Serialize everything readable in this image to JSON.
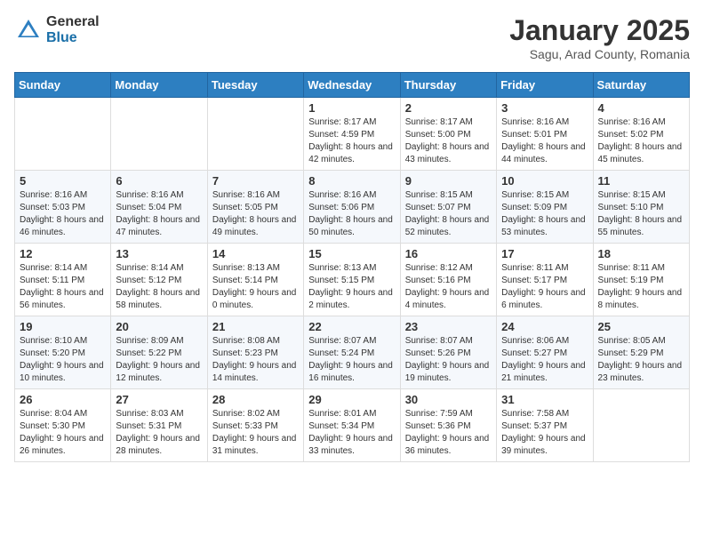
{
  "header": {
    "logo_general": "General",
    "logo_blue": "Blue",
    "month": "January 2025",
    "location": "Sagu, Arad County, Romania"
  },
  "weekdays": [
    "Sunday",
    "Monday",
    "Tuesday",
    "Wednesday",
    "Thursday",
    "Friday",
    "Saturday"
  ],
  "weeks": [
    [
      {
        "day": "",
        "info": ""
      },
      {
        "day": "",
        "info": ""
      },
      {
        "day": "",
        "info": ""
      },
      {
        "day": "1",
        "info": "Sunrise: 8:17 AM\nSunset: 4:59 PM\nDaylight: 8 hours and 42 minutes."
      },
      {
        "day": "2",
        "info": "Sunrise: 8:17 AM\nSunset: 5:00 PM\nDaylight: 8 hours and 43 minutes."
      },
      {
        "day": "3",
        "info": "Sunrise: 8:16 AM\nSunset: 5:01 PM\nDaylight: 8 hours and 44 minutes."
      },
      {
        "day": "4",
        "info": "Sunrise: 8:16 AM\nSunset: 5:02 PM\nDaylight: 8 hours and 45 minutes."
      }
    ],
    [
      {
        "day": "5",
        "info": "Sunrise: 8:16 AM\nSunset: 5:03 PM\nDaylight: 8 hours and 46 minutes."
      },
      {
        "day": "6",
        "info": "Sunrise: 8:16 AM\nSunset: 5:04 PM\nDaylight: 8 hours and 47 minutes."
      },
      {
        "day": "7",
        "info": "Sunrise: 8:16 AM\nSunset: 5:05 PM\nDaylight: 8 hours and 49 minutes."
      },
      {
        "day": "8",
        "info": "Sunrise: 8:16 AM\nSunset: 5:06 PM\nDaylight: 8 hours and 50 minutes."
      },
      {
        "day": "9",
        "info": "Sunrise: 8:15 AM\nSunset: 5:07 PM\nDaylight: 8 hours and 52 minutes."
      },
      {
        "day": "10",
        "info": "Sunrise: 8:15 AM\nSunset: 5:09 PM\nDaylight: 8 hours and 53 minutes."
      },
      {
        "day": "11",
        "info": "Sunrise: 8:15 AM\nSunset: 5:10 PM\nDaylight: 8 hours and 55 minutes."
      }
    ],
    [
      {
        "day": "12",
        "info": "Sunrise: 8:14 AM\nSunset: 5:11 PM\nDaylight: 8 hours and 56 minutes."
      },
      {
        "day": "13",
        "info": "Sunrise: 8:14 AM\nSunset: 5:12 PM\nDaylight: 8 hours and 58 minutes."
      },
      {
        "day": "14",
        "info": "Sunrise: 8:13 AM\nSunset: 5:14 PM\nDaylight: 9 hours and 0 minutes."
      },
      {
        "day": "15",
        "info": "Sunrise: 8:13 AM\nSunset: 5:15 PM\nDaylight: 9 hours and 2 minutes."
      },
      {
        "day": "16",
        "info": "Sunrise: 8:12 AM\nSunset: 5:16 PM\nDaylight: 9 hours and 4 minutes."
      },
      {
        "day": "17",
        "info": "Sunrise: 8:11 AM\nSunset: 5:17 PM\nDaylight: 9 hours and 6 minutes."
      },
      {
        "day": "18",
        "info": "Sunrise: 8:11 AM\nSunset: 5:19 PM\nDaylight: 9 hours and 8 minutes."
      }
    ],
    [
      {
        "day": "19",
        "info": "Sunrise: 8:10 AM\nSunset: 5:20 PM\nDaylight: 9 hours and 10 minutes."
      },
      {
        "day": "20",
        "info": "Sunrise: 8:09 AM\nSunset: 5:22 PM\nDaylight: 9 hours and 12 minutes."
      },
      {
        "day": "21",
        "info": "Sunrise: 8:08 AM\nSunset: 5:23 PM\nDaylight: 9 hours and 14 minutes."
      },
      {
        "day": "22",
        "info": "Sunrise: 8:07 AM\nSunset: 5:24 PM\nDaylight: 9 hours and 16 minutes."
      },
      {
        "day": "23",
        "info": "Sunrise: 8:07 AM\nSunset: 5:26 PM\nDaylight: 9 hours and 19 minutes."
      },
      {
        "day": "24",
        "info": "Sunrise: 8:06 AM\nSunset: 5:27 PM\nDaylight: 9 hours and 21 minutes."
      },
      {
        "day": "25",
        "info": "Sunrise: 8:05 AM\nSunset: 5:29 PM\nDaylight: 9 hours and 23 minutes."
      }
    ],
    [
      {
        "day": "26",
        "info": "Sunrise: 8:04 AM\nSunset: 5:30 PM\nDaylight: 9 hours and 26 minutes."
      },
      {
        "day": "27",
        "info": "Sunrise: 8:03 AM\nSunset: 5:31 PM\nDaylight: 9 hours and 28 minutes."
      },
      {
        "day": "28",
        "info": "Sunrise: 8:02 AM\nSunset: 5:33 PM\nDaylight: 9 hours and 31 minutes."
      },
      {
        "day": "29",
        "info": "Sunrise: 8:01 AM\nSunset: 5:34 PM\nDaylight: 9 hours and 33 minutes."
      },
      {
        "day": "30",
        "info": "Sunrise: 7:59 AM\nSunset: 5:36 PM\nDaylight: 9 hours and 36 minutes."
      },
      {
        "day": "31",
        "info": "Sunrise: 7:58 AM\nSunset: 5:37 PM\nDaylight: 9 hours and 39 minutes."
      },
      {
        "day": "",
        "info": ""
      }
    ]
  ]
}
